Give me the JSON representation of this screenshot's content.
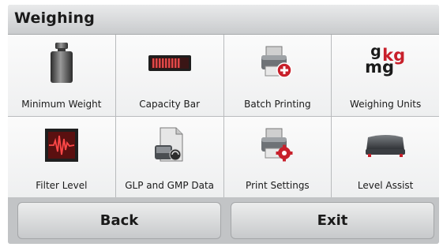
{
  "header": {
    "title": "Weighing"
  },
  "tiles": [
    {
      "label": "Minimum Weight",
      "icon": "weight-icon"
    },
    {
      "label": "Capacity Bar",
      "icon": "capacity-bar-icon"
    },
    {
      "label": "Batch Printing",
      "icon": "batch-printer-icon"
    },
    {
      "label": "Weighing Units",
      "icon": "units-icon",
      "units_text": {
        "g": "g",
        "kg": "kg",
        "mg": "mg"
      }
    },
    {
      "label": "Filter Level",
      "icon": "filter-level-icon"
    },
    {
      "label": "GLP and GMP Data",
      "icon": "glp-gmp-document-icon"
    },
    {
      "label": "Print Settings",
      "icon": "printer-settings-icon"
    },
    {
      "label": "Level Assist",
      "icon": "level-assist-icon"
    }
  ],
  "footer": {
    "back_label": "Back",
    "exit_label": "Exit"
  },
  "colors": {
    "accent_red": "#c8202b",
    "header_bg": "#dcdedf"
  }
}
